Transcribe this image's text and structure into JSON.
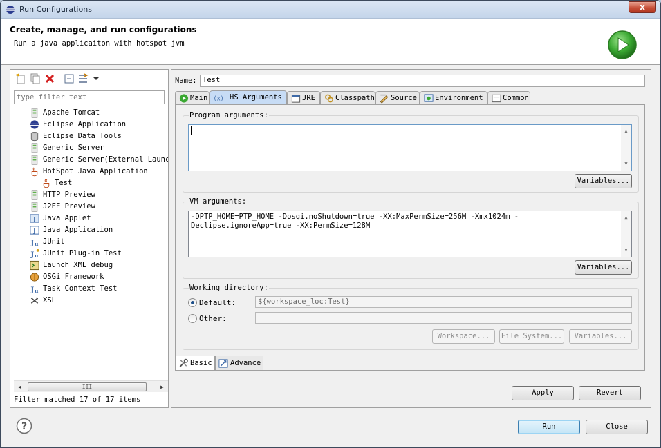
{
  "window": {
    "title": "Run Configurations",
    "close_label": "x"
  },
  "header": {
    "title": "Create, manage, and run configurations",
    "subtitle": "Run a java applicaiton with hotspot jvm"
  },
  "left": {
    "filter_placeholder": "type filter text",
    "tree": [
      {
        "label": "Apache Tomcat",
        "icon": "server-icon",
        "indent": 1
      },
      {
        "label": "Eclipse Application",
        "icon": "eclipse-icon",
        "indent": 1
      },
      {
        "label": "Eclipse Data Tools",
        "icon": "database-icon",
        "indent": 1
      },
      {
        "label": "Generic Server",
        "icon": "server-icon",
        "indent": 1
      },
      {
        "label": "Generic Server(External Launc",
        "icon": "server-icon",
        "indent": 1
      },
      {
        "label": "HotSpot Java Application",
        "icon": "java-cup-icon",
        "indent": 1
      },
      {
        "label": "Test",
        "icon": "java-cup-icon",
        "indent": 2,
        "selected": true
      },
      {
        "label": "HTTP Preview",
        "icon": "server-icon",
        "indent": 1
      },
      {
        "label": "J2EE Preview",
        "icon": "server-icon",
        "indent": 1
      },
      {
        "label": "Java Applet",
        "icon": "applet-icon",
        "indent": 1
      },
      {
        "label": "Java Application",
        "icon": "java-app-icon",
        "indent": 1
      },
      {
        "label": "JUnit",
        "icon": "junit-icon",
        "indent": 1
      },
      {
        "label": "JUnit Plug-in Test",
        "icon": "junit-plugin-icon",
        "indent": 1
      },
      {
        "label": "Launch XML debug",
        "icon": "xml-debug-icon",
        "indent": 1
      },
      {
        "label": "OSGi Framework",
        "icon": "osgi-icon",
        "indent": 1
      },
      {
        "label": "Task Context Test",
        "icon": "junit-icon",
        "indent": 1
      },
      {
        "label": "XSL",
        "icon": "xsl-icon",
        "indent": 1
      }
    ],
    "scroll_grip": "III",
    "status": "Filter matched 17 of 17 items"
  },
  "right": {
    "name_label": "Name:",
    "name_value": "Test",
    "tabs": [
      {
        "label": "Main",
        "icon": "main-tab-icon"
      },
      {
        "label": "HS Arguments",
        "icon": "arguments-tab-icon",
        "active": true
      },
      {
        "label": "JRE",
        "icon": "jre-tab-icon"
      },
      {
        "label": "Classpath",
        "icon": "classpath-tab-icon"
      },
      {
        "label": "Source",
        "icon": "source-tab-icon"
      },
      {
        "label": "Environment",
        "icon": "environment-tab-icon"
      },
      {
        "label": "Common",
        "icon": "common-tab-icon"
      }
    ],
    "program_args": {
      "label": "Program arguments:",
      "value": "",
      "variables_button": "Variables..."
    },
    "vm_args": {
      "label": "VM arguments:",
      "value": "-DPTP_HOME=PTP_HOME -Dosgi.noShutdown=true -XX:MaxPermSize=256M -Xmx1024m -Declipse.ignoreApp=true -XX:PermSize=128M",
      "variables_button": "Variables..."
    },
    "working_dir": {
      "label": "Working directory:",
      "default_label": "Default:",
      "default_value": "${workspace_loc:Test}",
      "other_label": "Other:",
      "other_value": "",
      "workspace_button": "Workspace...",
      "filesystem_button": "File System...",
      "variables_button": "Variables..."
    },
    "bottom_tabs": [
      {
        "label": "Basic",
        "icon": "tools-icon",
        "active": true
      },
      {
        "label": "Advance",
        "icon": "advance-icon"
      }
    ],
    "apply_button": "Apply",
    "revert_button": "Revert"
  },
  "footer": {
    "run_button": "Run",
    "close_button": "Close"
  },
  "colors": {
    "accent": "#3c7fb1",
    "run_green": "#3aa832",
    "delete_red": "#d42020"
  }
}
